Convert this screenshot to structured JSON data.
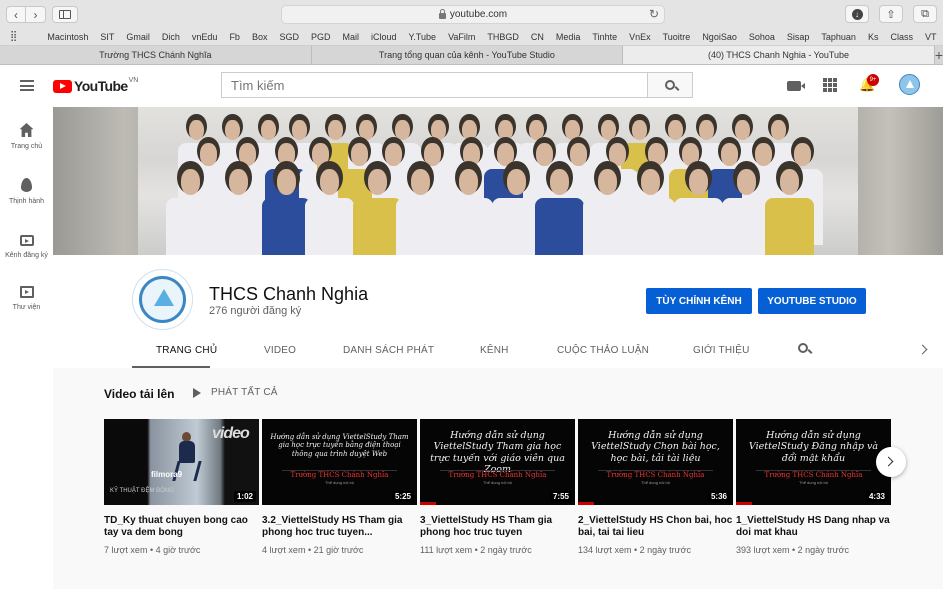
{
  "browser": {
    "url": "youtube.com",
    "bookmarks": [
      "Macintosh",
      "SIT",
      "Gmail",
      "Dich",
      "vnEdu",
      "Fb",
      "Box",
      "SGD",
      "PGD",
      "Mail",
      "iCloud",
      "Y.Tube",
      "VaFilm",
      "THBGD",
      "CN",
      "Media",
      "Tinhte",
      "VnEx",
      "Tuoitre",
      "NgoiSao",
      "Sohoa",
      "Sisap",
      "Taphuan",
      "Ks",
      "Class",
      "VT"
    ],
    "tabs": [
      {
        "label": "Trường THCS Chánh Nghĩa",
        "active": false
      },
      {
        "label": "Trang tổng quan của kênh - YouTube Studio",
        "active": false
      },
      {
        "label": "(40) THCS Chanh Nghia - YouTube",
        "active": true
      }
    ],
    "new_tab": "+"
  },
  "header": {
    "logo_text": "YouTube",
    "logo_region": "VN",
    "search_placeholder": "Tìm kiếm",
    "notification_count": "9+"
  },
  "sidebar": {
    "items": [
      {
        "label": "Trang chủ",
        "icon": "home-icon"
      },
      {
        "label": "Thịnh hành",
        "icon": "trending-icon"
      },
      {
        "label": "Kênh đăng ký",
        "icon": "subscriptions-icon"
      },
      {
        "label": "Thư viện",
        "icon": "library-icon"
      }
    ]
  },
  "channel": {
    "name": "THCS Chanh Nghia",
    "subscribers": "276 người đăng ký",
    "customize_label": "TÙY CHỈNH KÊNH",
    "studio_label": "YOUTUBE STUDIO",
    "tabs": [
      "TRANG CHỦ",
      "VIDEO",
      "DANH SÁCH PHÁT",
      "KÊNH",
      "CUỘC THẢO LUẬN",
      "GIỚI THIỆU"
    ]
  },
  "section": {
    "title": "Video tải lên",
    "play_all": "PHÁT TẤT CẢ"
  },
  "videos": [
    {
      "title": "TD_Ky thuat chuyen bong cao tay va dem bong",
      "duration": "1:02",
      "views": "7 lượt xem",
      "age": "4 giờ trước",
      "progress": 0,
      "thumb_text": "",
      "thumb_logo": "filmora9",
      "thumb_brand": "video",
      "thumb_footer": "KỸ THUẬT ĐỆM BÓNG"
    },
    {
      "title": "3.2_ViettelStudy HS Tham gia phong hoc truc tuyen...",
      "duration": "5:25",
      "views": "4 lượt xem",
      "age": "21 giờ trước",
      "progress": 0,
      "thumb_text": "Hướng dẫn sử dụng ViettelStudy Tham gia học trực tuyến bằng điện thoại thông qua trình duyệt Web",
      "thumb_sub": "Trường THCS Chánh Nghĩa",
      "thumb_sub2": "Thể dụng nội bộ"
    },
    {
      "title": "3_ViettelStudy HS Tham gia phong hoc truc tuyen",
      "duration": "7:55",
      "views": "111 lượt xem",
      "age": "2 ngày trước",
      "progress": 0.1,
      "thumb_text": "Hướng dẫn sử dụng ViettelStudy Tham gia học trực tuyến với giáo viên qua Zoom",
      "thumb_sub": "Trường THCS Chánh Nghĩa",
      "thumb_sub2": "Thể dụng nội bộ"
    },
    {
      "title": "2_ViettelStudy HS Chon bai, hoc bai, tai tai lieu",
      "duration": "5:36",
      "views": "134 lượt xem",
      "age": "2 ngày trước",
      "progress": 0.1,
      "thumb_text": "Hướng dẫn sử dụng ViettelStudy Chọn bài học, học bài, tải tài liệu",
      "thumb_sub": "Trường THCS Chánh Nghĩa",
      "thumb_sub2": "Thể dụng nội bộ"
    },
    {
      "title": "1_ViettelStudy HS Dang nhap va doi mat khau",
      "duration": "4:33",
      "views": "393 lượt xem",
      "age": "2 ngày trước",
      "progress": 0.1,
      "thumb_text": "Hướng dẫn sử dụng ViettelStudy Đăng nhập và đổi mật khẩu",
      "thumb_sub": "Trường THCS Chánh Nghĩa",
      "thumb_sub2": "Thể dụng nội bộ"
    }
  ],
  "colors": {
    "accent": "#065fd4",
    "brand": "#ff0000"
  }
}
